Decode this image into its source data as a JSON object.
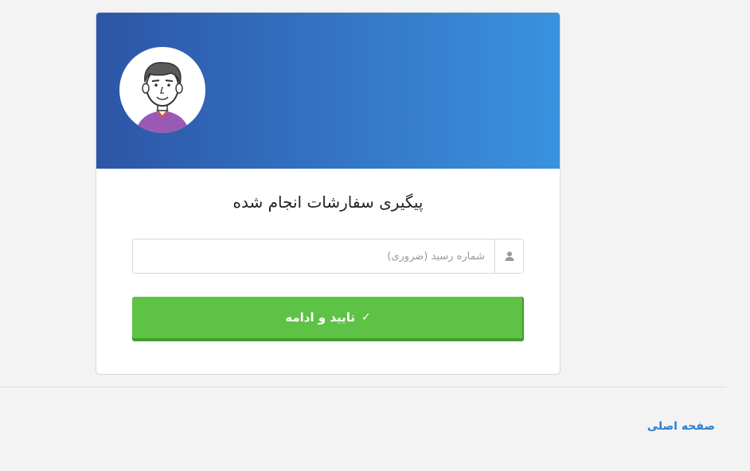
{
  "card": {
    "title": "پیگیری سفارشات انجام شده",
    "avatar_icon": "user-avatar-illustration"
  },
  "form": {
    "receipt_placeholder": "شماره رسید (ضروری)",
    "receipt_value": "",
    "receipt_icon": "user-icon",
    "submit_label": "تایید و ادامه",
    "submit_icon": "✓"
  },
  "footer": {
    "home_link": "صفحه اصلی"
  },
  "colors": {
    "header_gradient_start": "#2d55a6",
    "header_gradient_end": "#3a92df",
    "button": "#5dc245",
    "link": "#2a7fd4"
  }
}
